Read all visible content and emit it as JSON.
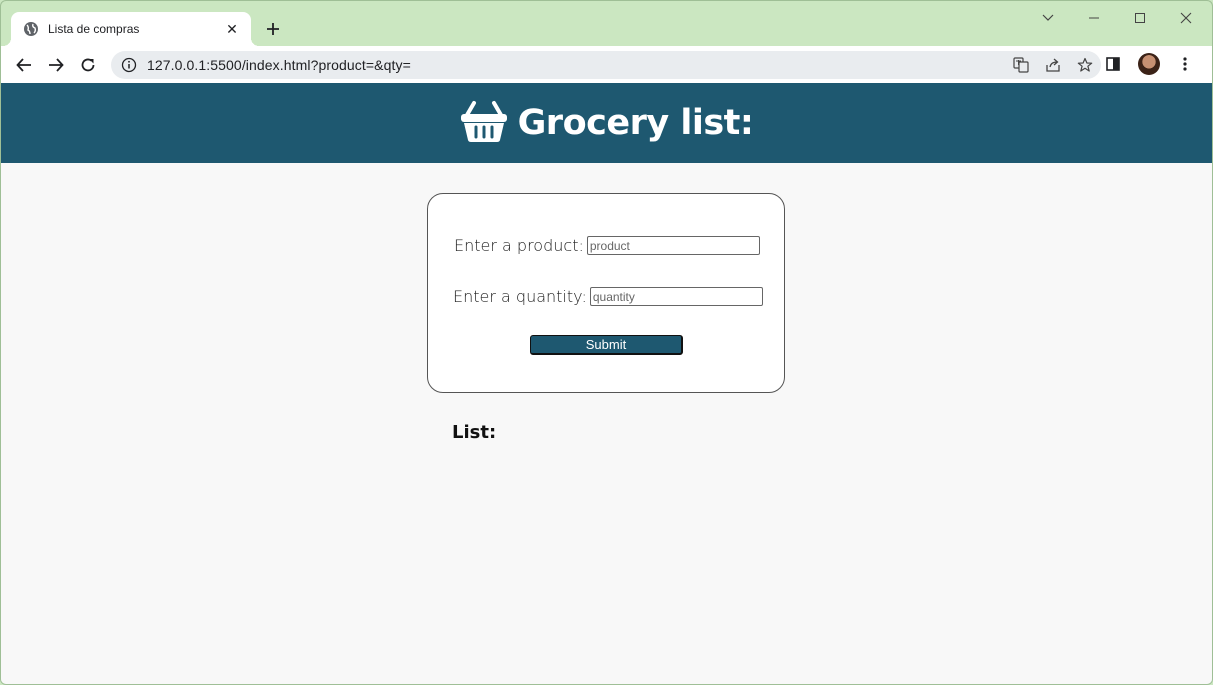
{
  "browser": {
    "tab_title": "Lista de compras",
    "url": "127.0.0.1:5500/index.html?product=&qty=",
    "tab_close_glyph": "✕",
    "new_tab_glyph": "+"
  },
  "page": {
    "header_title": "Grocery list:",
    "product_label": "Enter a product:",
    "product_placeholder": "product",
    "product_value": "",
    "quantity_label": "Enter a quantity:",
    "quantity_placeholder": "quantity",
    "quantity_value": "",
    "submit_label": "Submit",
    "list_heading": "List:"
  },
  "colors": {
    "header_bg": "#1e5870",
    "tabstrip_bg": "#cbe7c1",
    "page_bg": "#f8f8f8"
  },
  "icons": {
    "header": "basket-icon",
    "tab": "globe-icon"
  }
}
